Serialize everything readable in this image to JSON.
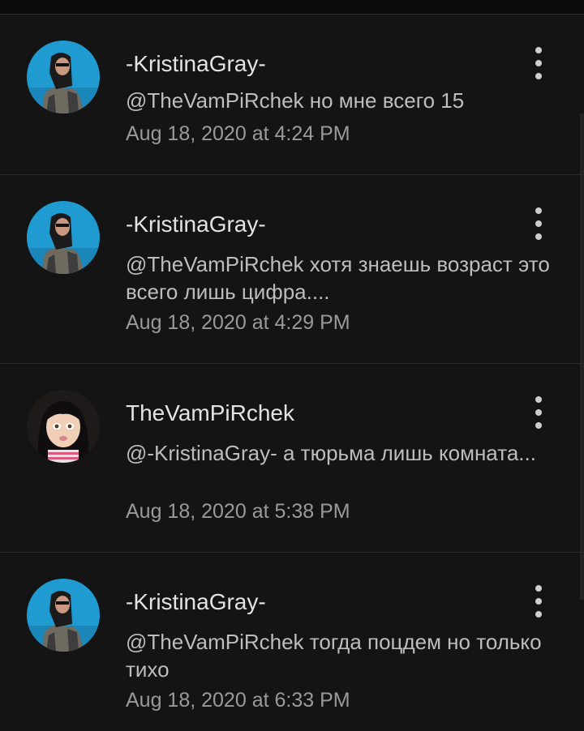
{
  "comments": [
    {
      "author": "-KristinaGray-",
      "avatar": "kristina",
      "text": "@TheVamPiRchek но мне всего 15",
      "date": "Aug 18, 2020 at 4:24 PM"
    },
    {
      "author": "-KristinaGray-",
      "avatar": "kristina",
      "text": "@TheVamPiRchek хотя знаешь возраст это всего лишь цифра....",
      "date": "Aug 18, 2020 at 4:29 PM"
    },
    {
      "author": "TheVamPiRchek",
      "avatar": "doll",
      "text": "@-KristinaGray-  а тюрьма лишь комната...",
      "date": "Aug 18, 2020 at 5:38 PM"
    },
    {
      "author": "-KristinaGray-",
      "avatar": "kristina",
      "text": "@TheVamPiRchek тогда поцдем но только тихо",
      "date": "Aug 18, 2020 at 6:33 PM"
    }
  ],
  "icons": {
    "menu": "more-vertical-icon"
  },
  "colors": {
    "background": "#141414",
    "text": "#bdbdbd",
    "meta": "#9a9a9a"
  }
}
